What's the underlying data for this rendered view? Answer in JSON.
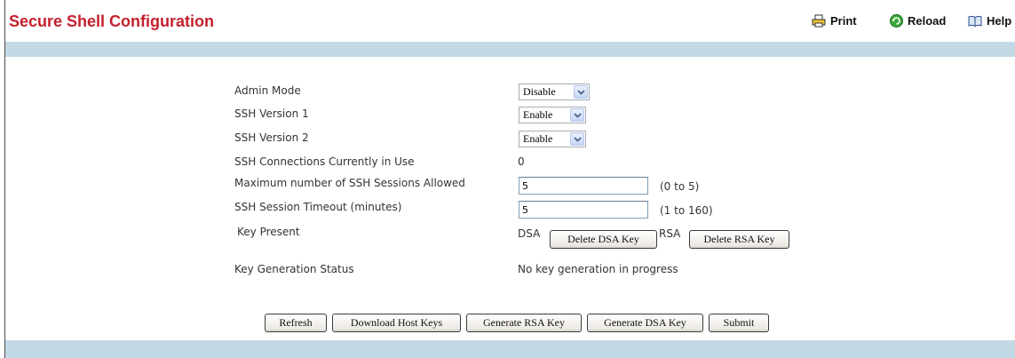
{
  "header": {
    "title": "Secure Shell Configuration",
    "print_label": "Print",
    "reload_label": "Reload",
    "help_label": "Help"
  },
  "form": {
    "admin_mode": {
      "label": "Admin Mode",
      "value": "Disable"
    },
    "ssh_v1": {
      "label": "SSH Version 1",
      "value": "Enable"
    },
    "ssh_v2": {
      "label": "SSH Version 2",
      "value": "Enable"
    },
    "connections": {
      "label": "SSH Connections Currently in Use",
      "value": "0"
    },
    "max_sessions": {
      "label": "Maximum number of SSH Sessions Allowed",
      "value": "5",
      "range": "(0 to 5)"
    },
    "timeout": {
      "label": "SSH Session Timeout (minutes)",
      "value": "5",
      "range": "(1 to 160)"
    },
    "key_present": {
      "label": "Key Present",
      "dsa_label": "DSA",
      "delete_dsa": "Delete DSA Key",
      "rsa_label": "RSA",
      "delete_rsa": "Delete RSA Key"
    },
    "key_gen_status": {
      "label": "Key Generation Status",
      "value": "No key generation in progress"
    }
  },
  "actions": {
    "refresh": "Refresh",
    "download_host_keys": "Download Host Keys",
    "generate_rsa": "Generate RSA Key",
    "generate_dsa": "Generate DSA Key",
    "submit": "Submit"
  },
  "colors": {
    "title": "#c5202e",
    "band": "#c4d9e6"
  },
  "icons": {
    "print": "printer-icon",
    "reload": "reload-icon",
    "help": "help-book-icon",
    "dropdown": "chevron-down-icon"
  }
}
